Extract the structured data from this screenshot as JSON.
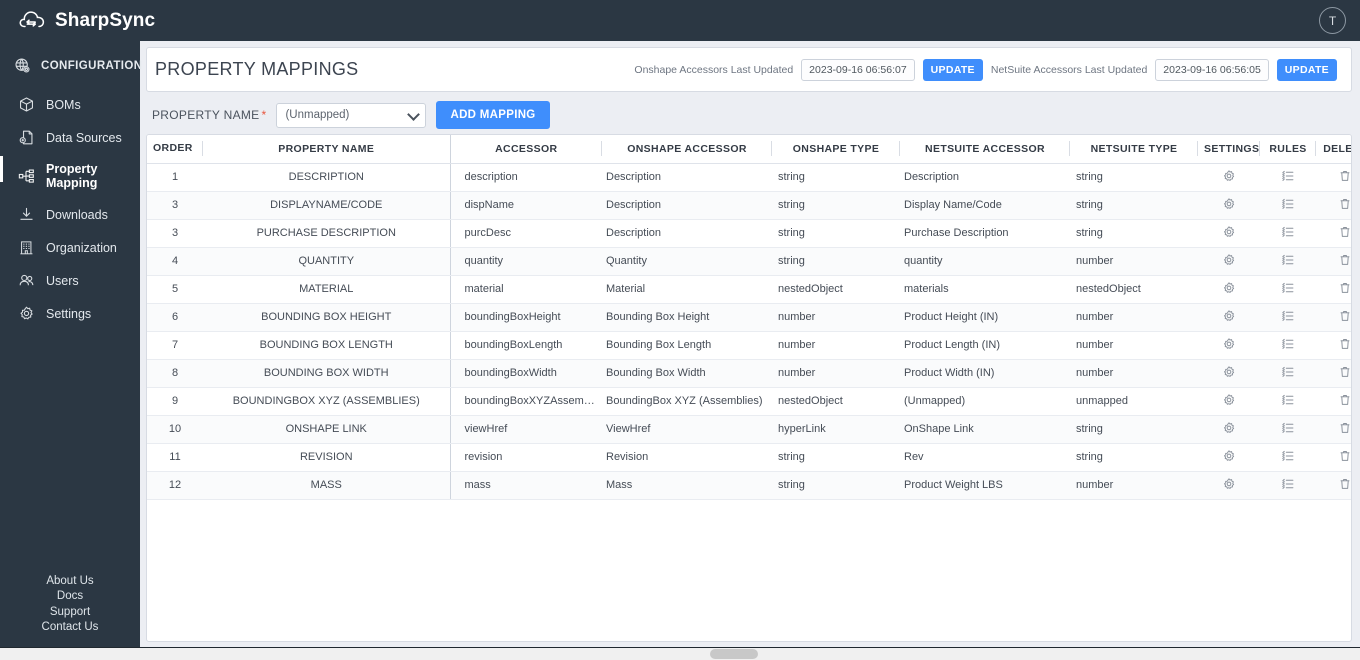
{
  "app": {
    "brand": "SharpSync",
    "logo_icon": "cloud-sync-icon",
    "avatar_initial": "T"
  },
  "sidebar": {
    "section": {
      "label": "CONFIGURATION",
      "icon": "globe-gear-icon"
    },
    "items": [
      {
        "label": "BOMs",
        "icon": "cube-icon",
        "active": false
      },
      {
        "label": "Data Sources",
        "icon": "database-icon",
        "active": false
      },
      {
        "label": "Property Mapping",
        "icon": "nodes-icon",
        "active": true
      },
      {
        "label": "Downloads",
        "icon": "download-icon",
        "active": false
      },
      {
        "label": "Organization",
        "icon": "building-icon",
        "active": false
      },
      {
        "label": "Users",
        "icon": "users-icon",
        "active": false
      },
      {
        "label": "Settings",
        "icon": "gear-icon",
        "active": false
      }
    ],
    "footer_links": [
      "About Us",
      "Docs",
      "Support",
      "Contact Us"
    ]
  },
  "header": {
    "title": "PROPERTY MAPPINGS",
    "onshape_label": "Onshape Accessors Last Updated",
    "onshape_timestamp": "2023-09-16 06:56:07",
    "onshape_update_label": "UPDATE",
    "netsuite_label": "NetSuite Accessors Last Updated",
    "netsuite_timestamp": "2023-09-16 06:56:05",
    "netsuite_update_label": "UPDATE"
  },
  "filter": {
    "label": "PROPERTY NAME",
    "required_mark": "*",
    "selected_option": "(Unmapped)",
    "add_mapping_label": "ADD MAPPING"
  },
  "table": {
    "columns": [
      "ORDER",
      "PROPERTY NAME",
      "ACCESSOR",
      "ONSHAPE ACCESSOR",
      "ONSHAPE TYPE",
      "NETSUITE ACCESSOR",
      "NETSUITE TYPE",
      "SETTINGS",
      "RULES",
      "DELETE"
    ],
    "sort_column": "ORDER",
    "sort_direction": "asc",
    "row_icons": {
      "settings": "gear-icon",
      "rules": "list-rules-icon",
      "delete": "trash-icon"
    },
    "rows": [
      {
        "order": "1",
        "property_name": "DESCRIPTION",
        "accessor": "description",
        "onshape_accessor": "Description",
        "onshape_type": "string",
        "netsuite_accessor": "Description",
        "netsuite_type": "string"
      },
      {
        "order": "3",
        "property_name": "DISPLAYNAME/CODE",
        "accessor": "dispName",
        "onshape_accessor": "Description",
        "onshape_type": "string",
        "netsuite_accessor": "Display Name/Code",
        "netsuite_type": "string"
      },
      {
        "order": "3",
        "property_name": "PURCHASE DESCRIPTION",
        "accessor": "purcDesc",
        "onshape_accessor": "Description",
        "onshape_type": "string",
        "netsuite_accessor": "Purchase Description",
        "netsuite_type": "string"
      },
      {
        "order": "4",
        "property_name": "QUANTITY",
        "accessor": "quantity",
        "onshape_accessor": "Quantity",
        "onshape_type": "string",
        "netsuite_accessor": "quantity",
        "netsuite_type": "number"
      },
      {
        "order": "5",
        "property_name": "MATERIAL",
        "accessor": "material",
        "onshape_accessor": "Material",
        "onshape_type": "nestedObject",
        "netsuite_accessor": "materials",
        "netsuite_type": "nestedObject"
      },
      {
        "order": "6",
        "property_name": "BOUNDING BOX HEIGHT",
        "accessor": "boundingBoxHeight",
        "onshape_accessor": "Bounding Box Height",
        "onshape_type": "number",
        "netsuite_accessor": "Product Height (IN)",
        "netsuite_type": "number"
      },
      {
        "order": "7",
        "property_name": "BOUNDING BOX LENGTH",
        "accessor": "boundingBoxLength",
        "onshape_accessor": "Bounding Box Length",
        "onshape_type": "number",
        "netsuite_accessor": "Product Length (IN)",
        "netsuite_type": "number"
      },
      {
        "order": "8",
        "property_name": "BOUNDING BOX WIDTH",
        "accessor": "boundingBoxWidth",
        "onshape_accessor": "Bounding Box Width",
        "onshape_type": "number",
        "netsuite_accessor": "Product Width (IN)",
        "netsuite_type": "number"
      },
      {
        "order": "9",
        "property_name": "BOUNDINGBOX XYZ (ASSEMBLIES)",
        "accessor": "boundingBoxXYZAssemblies",
        "onshape_accessor": "BoundingBox XYZ (Assemblies)",
        "onshape_type": "nestedObject",
        "netsuite_accessor": "(Unmapped)",
        "netsuite_type": "unmapped"
      },
      {
        "order": "10",
        "property_name": "ONSHAPE LINK",
        "accessor": "viewHref",
        "onshape_accessor": "ViewHref",
        "onshape_type": "hyperLink",
        "netsuite_accessor": "OnShape Link",
        "netsuite_type": "string"
      },
      {
        "order": "11",
        "property_name": "REVISION",
        "accessor": "revision",
        "onshape_accessor": "Revision",
        "onshape_type": "string",
        "netsuite_accessor": "Rev",
        "netsuite_type": "string"
      },
      {
        "order": "12",
        "property_name": "MASS",
        "accessor": "mass",
        "onshape_accessor": "Mass",
        "onshape_type": "string",
        "netsuite_accessor": "Product Weight LBS",
        "netsuite_type": "number"
      }
    ]
  },
  "colors": {
    "sidebar_bg": "#2b3743",
    "accent_blue": "#3f8efc",
    "required_red": "#e8553d",
    "page_bg": "#eceef3"
  }
}
